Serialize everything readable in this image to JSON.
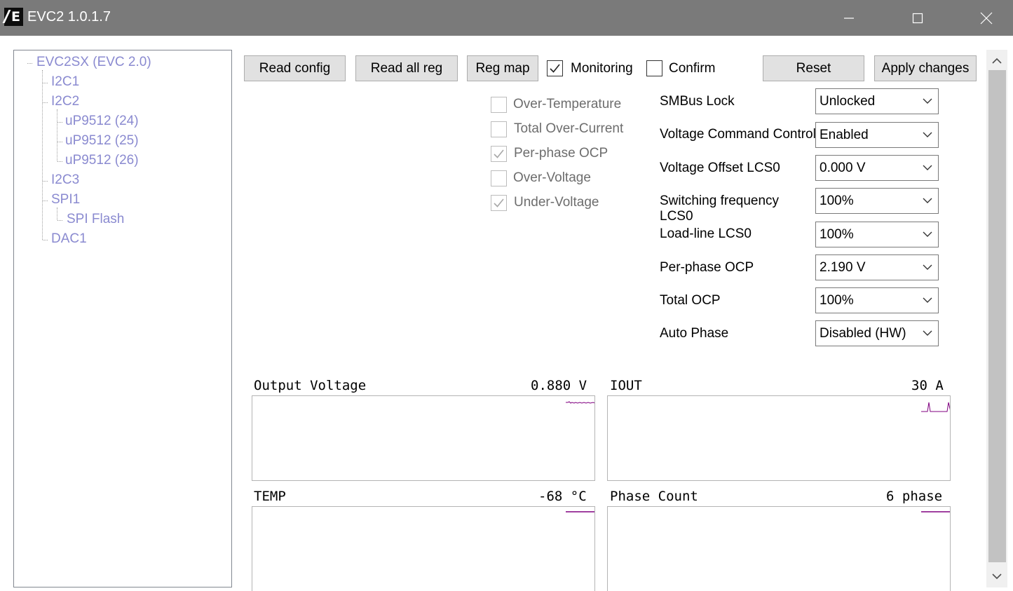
{
  "window": {
    "title": "EVC2 1.0.1.7",
    "logo_text": "E",
    "controls": [
      "minimize-icon",
      "maximize-icon",
      "close-icon"
    ]
  },
  "tree": {
    "root": "EVC2SX (EVC 2.0)",
    "i2c1": "I2C1",
    "i2c2": "I2C2",
    "up1": "uP9512 (24)",
    "up2": "uP9512 (25)",
    "up3": "uP9512 (26)",
    "i2c3": "I2C3",
    "spi1": "SPI1",
    "spiflash": "SPI Flash",
    "dac1": "DAC1"
  },
  "toolbar": {
    "read_config": "Read config",
    "read_all_reg": "Read all reg",
    "reg_map": "Reg map",
    "monitoring": "Monitoring",
    "monitoring_checked": true,
    "confirm": "Confirm",
    "confirm_checked": false,
    "reset": "Reset",
    "apply": "Apply changes"
  },
  "protections": {
    "over_temp": "Over-Temperature",
    "over_temp_checked": false,
    "total_oc": "Total Over-Current",
    "total_oc_checked": false,
    "perphase_ocp": "Per-phase OCP",
    "perphase_ocp_checked": true,
    "over_voltage": "Over-Voltage",
    "over_voltage_checked": false,
    "under_voltage": "Under-Voltage",
    "under_voltage_checked": true
  },
  "settings": {
    "smbus_lock": {
      "label": "SMBus Lock",
      "value": "Unlocked"
    },
    "vcc": {
      "label": "Voltage Command Control",
      "value": "Enabled"
    },
    "voffset": {
      "label": "Voltage Offset LCS0",
      "value": "0.000 V"
    },
    "swfreq": {
      "label": "Switching frequency LCS0",
      "value": "100%"
    },
    "loadline": {
      "label": "Load-line LCS0",
      "value": "100%"
    },
    "ppocp": {
      "label": "Per-phase OCP",
      "value": "2.190 V"
    },
    "tocp": {
      "label": "Total OCP",
      "value": "100%"
    },
    "autophase": {
      "label": "Auto Phase",
      "value": "Disabled (HW)"
    }
  },
  "graphs": {
    "vout": {
      "label": "Output Voltage",
      "value": "0.880 V"
    },
    "iout": {
      "label": "IOUT",
      "value": "30 A"
    },
    "temp": {
      "label": "TEMP",
      "value": "-68 °C"
    },
    "phase": {
      "label": "Phase Count",
      "value": "6 phase"
    }
  },
  "colors": {
    "titlebar": "#7a7a7a",
    "tree_text": "#8a8ad0",
    "trace": "#800080",
    "button_face": "#e1e1e1"
  }
}
